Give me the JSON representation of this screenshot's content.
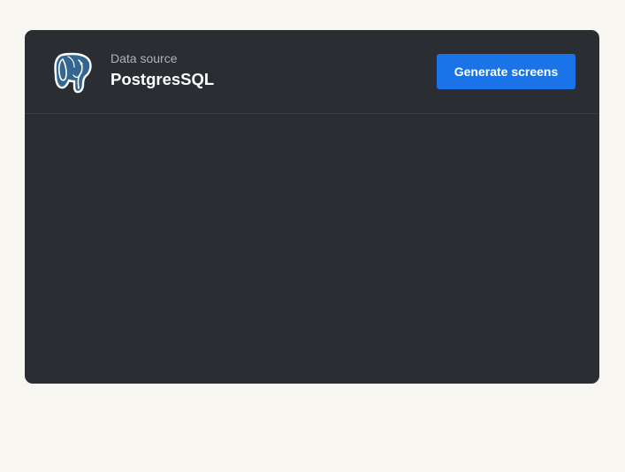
{
  "data_source": {
    "caption": "Data source",
    "name": "PostgresSQL",
    "icon": "postgresql-elephant-icon"
  },
  "actions": {
    "generate_label": "Generate screens"
  },
  "colors": {
    "page_background": "#f8f6f1",
    "card_background": "#2a2d32",
    "accent": "#1b73e8",
    "logo_blue": "#336791"
  }
}
